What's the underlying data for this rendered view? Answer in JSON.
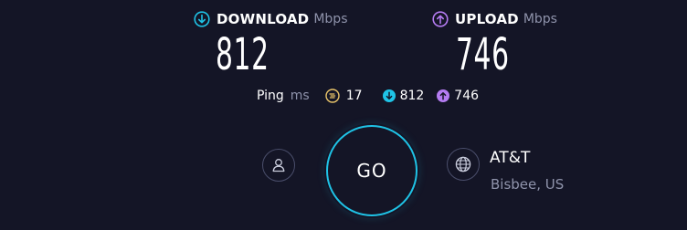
{
  "download": {
    "title": "DOWNLOAD",
    "unit": "Mbps",
    "value": "812",
    "icon": "download-arrow-icon",
    "color": "#1fc3e6"
  },
  "upload": {
    "title": "UPLOAD",
    "unit": "Mbps",
    "value": "746",
    "icon": "upload-arrow-icon",
    "color": "#b57cf2"
  },
  "ping": {
    "label": "Ping",
    "unit": "ms",
    "idle_value": "17",
    "download_value": "812",
    "upload_value": "746",
    "idle_icon": "latency-icon",
    "idle_color": "#e9c46a"
  },
  "go_button": {
    "label": "GO",
    "color": "#1fc3e6"
  },
  "user": {
    "icon": "user-icon"
  },
  "server": {
    "icon": "globe-icon",
    "name": "AT&T",
    "location": "Bisbee, US"
  }
}
